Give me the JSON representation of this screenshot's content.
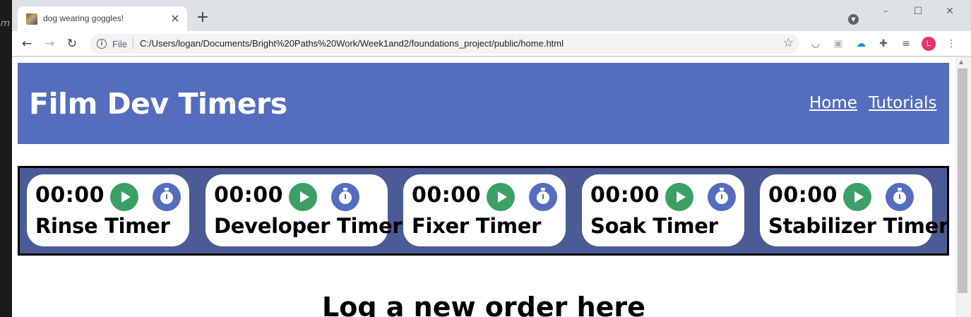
{
  "browser": {
    "tab_title": "dog wearing goggles!",
    "tab_close": "×",
    "new_tab": "+",
    "file_label": "File",
    "url": "C:/Users/logan/Documents/Bright%20Paths%20Work/Week1and2/foundations_project/public/home.html",
    "avatar_letter": "L",
    "controls": {
      "minimize": "–",
      "maximize": "☐",
      "close": "✕"
    },
    "icons": [
      "back-arrow-icon",
      "forward-arrow-icon",
      "reload-icon",
      "info-icon",
      "star-icon",
      "pocket-icon",
      "camera-icon",
      "cloud-icon",
      "puzzle-icon",
      "playlist-icon",
      "menu-dots-icon"
    ]
  },
  "header": {
    "title": "Film Dev Timers",
    "nav": [
      {
        "label": "Home"
      },
      {
        "label": "Tutorials"
      }
    ],
    "color": "#546dbe"
  },
  "timers": [
    {
      "time": "00:00",
      "label": "Rinse Timer"
    },
    {
      "time": "00:00",
      "label": "Developer Timer"
    },
    {
      "time": "00:00",
      "label": "Fixer Timer"
    },
    {
      "time": "00:00",
      "label": "Soak Timer"
    },
    {
      "time": "00:00",
      "label": "Stabilizer Timer"
    }
  ],
  "colors": {
    "play": "#3ba065",
    "stopwatch": "#546dbe",
    "strip": "#4a5b96"
  },
  "main": {
    "heading": "Log a new order here"
  }
}
